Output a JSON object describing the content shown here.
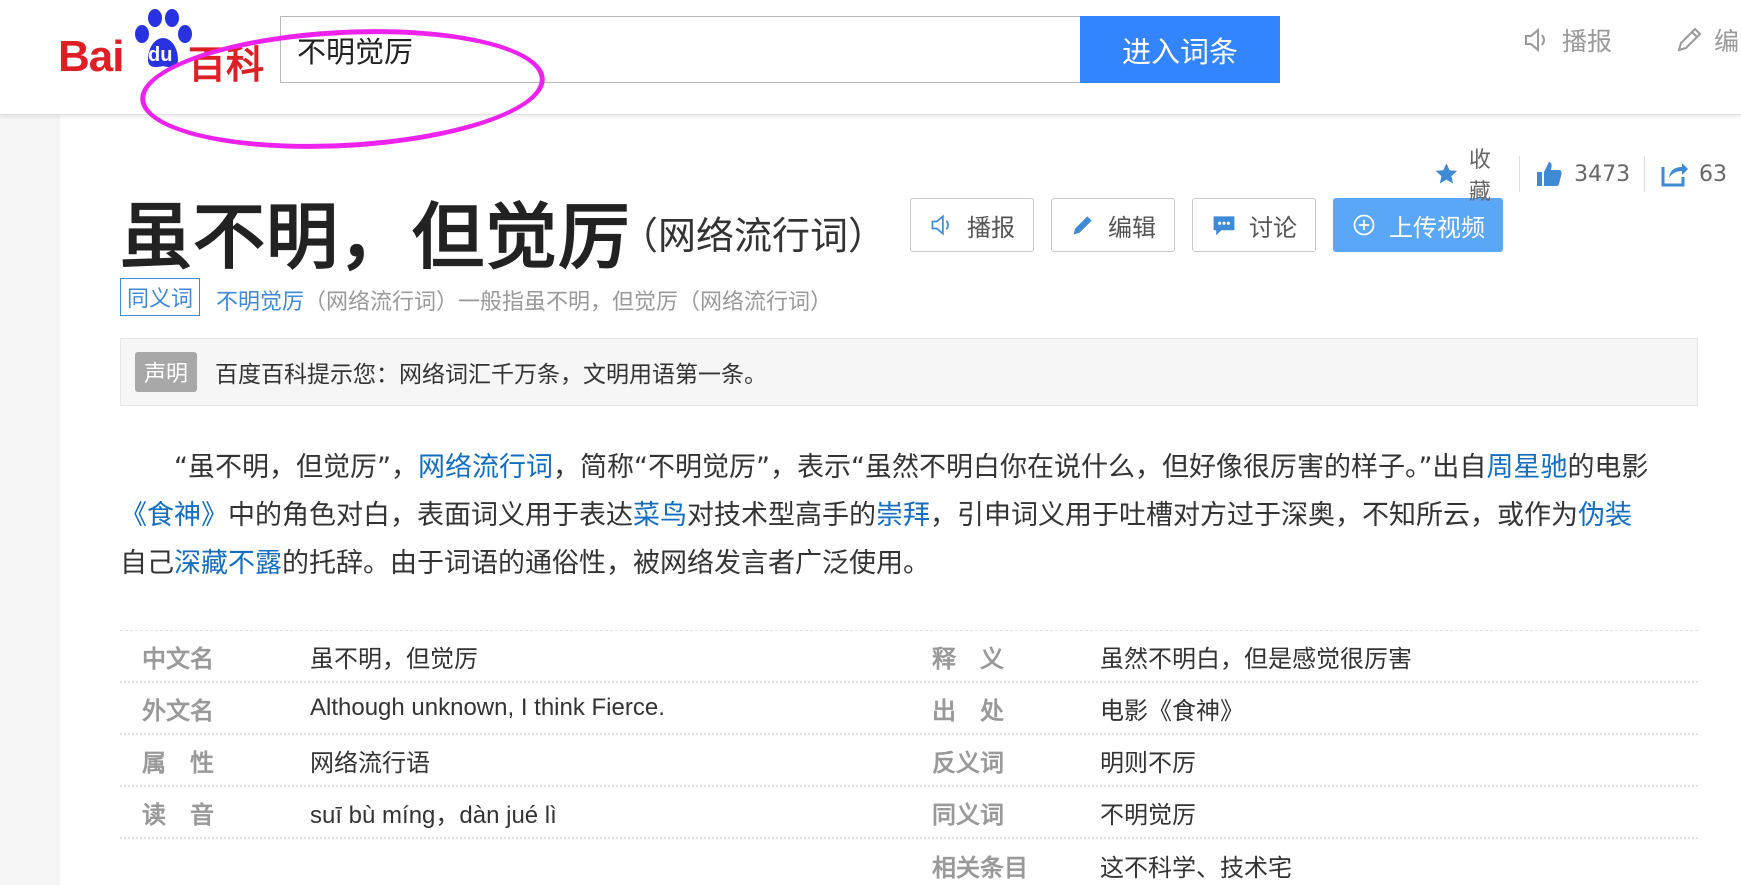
{
  "header": {
    "logo": {
      "bai": "Bai",
      "du": "du",
      "baike": "百科"
    },
    "search": {
      "value": "不明觉厉"
    },
    "search_button": "进入词条",
    "actions": [
      {
        "label": "播报",
        "icon": "speaker-icon"
      },
      {
        "label": "编",
        "icon": "pencil-icon"
      }
    ]
  },
  "tools": {
    "collect": "收藏",
    "likes": "3473",
    "shares": "63"
  },
  "entry": {
    "title": "虽不明，但觉厉",
    "subtitle": "（网络流行词）",
    "buttons": {
      "broadcast": "播报",
      "edit": "编辑",
      "discuss": "讨论",
      "upload": "上传视频"
    },
    "synonym": {
      "tag": "同义词",
      "link": "不明觉厉",
      "rest": "（网络流行词）一般指虽不明，但觉厉（网络流行词）"
    },
    "notice": {
      "tag": "声明",
      "text": "百度百科提示您：网络词汇千万条，文明用语第一条。"
    },
    "summary": {
      "p1": "“虽不明，但觉厉”，",
      "l1": "网络流行词",
      "p2": "，简称“不明觉厉”，表示“虽然不明白你在说什么，但好像很厉害的样子。”出自",
      "l2": "周星驰",
      "p3": "的电影",
      "l3": "《食神》",
      "p4": "中的角色对白，表面词义用于表达",
      "l4": "菜鸟",
      "p5": "对技术型高手的",
      "l5": "崇拜",
      "p6": "，引申词义用于吐槽对方过于深奥，不知所云，或作为",
      "l6": "伪装",
      "p7": "自己",
      "l7": "深藏不露",
      "p8": "的托辞。由于词语的通俗性，被网络发言者广泛使用。"
    },
    "basic_info": {
      "left": [
        {
          "key": "中文名",
          "value": "虽不明，但觉厉"
        },
        {
          "key": "外文名",
          "value": "Although unknown, I think Fierce."
        },
        {
          "key": "属　性",
          "value": "网络流行语"
        },
        {
          "key": "读　音",
          "value": "suī bù míng，dàn jué lì"
        }
      ],
      "right": [
        {
          "key": "释　义",
          "value": "虽然不明白，但是感觉很厉害"
        },
        {
          "key": "出　处",
          "value": "电影《食神》"
        },
        {
          "key": "反义词",
          "value": "明则不厉"
        },
        {
          "key": "同义词",
          "value": "不明觉厉"
        },
        {
          "key": "相关条目",
          "value": "这不科学、技术宅"
        }
      ]
    }
  },
  "colors": {
    "brand_red": "#de1f26",
    "brand_blue": "#2932e1",
    "search_button": "#3385ff",
    "link": "#136ec2",
    "annotation": "#ee22ee"
  }
}
